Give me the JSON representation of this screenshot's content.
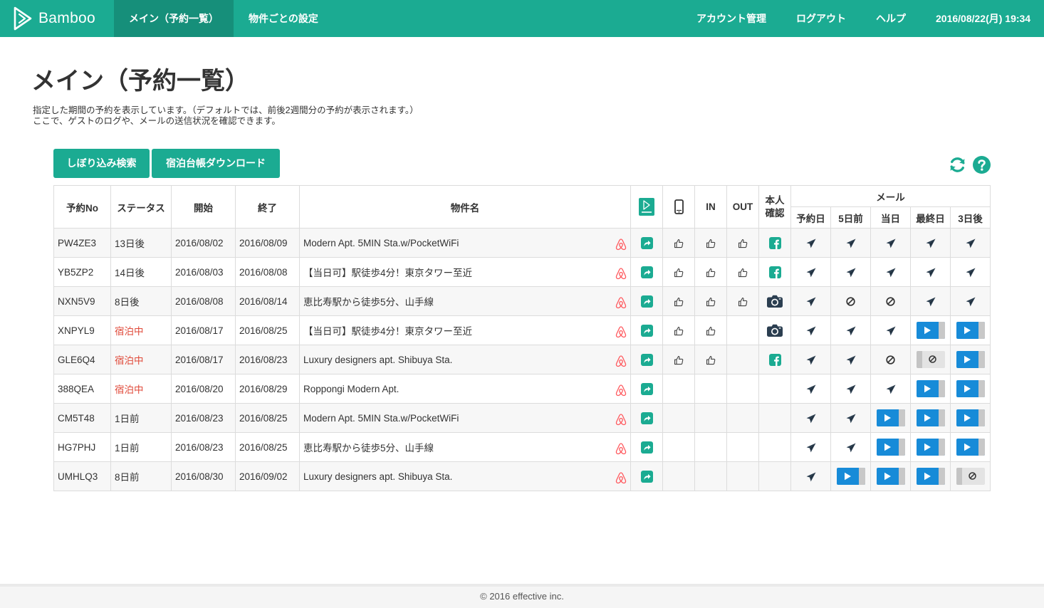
{
  "app": {
    "name": "Bamboo"
  },
  "nav": {
    "main": "メイン（予約一覧）",
    "settings": "物件ごとの設定",
    "account": "アカウント管理",
    "logout": "ログアウト",
    "help": "ヘルプ",
    "datetime": "2016/08/22(月) 19:34"
  },
  "colors": {
    "brand": "#1bab92",
    "brand_dark": "#168f7a",
    "alert": "#e04a3a",
    "play": "#178bd8",
    "airbnb": "#ff5a5f"
  },
  "page": {
    "title": "メイン（予約一覧）",
    "desc1": "指定した期間の予約を表示しています。（デフォルトでは、前後2週間分の予約が表示されます。）",
    "desc2": "ここで、ゲストのログや、メールの送信状況を確認できます。"
  },
  "buttons": {
    "filter": "しぼり込み検索",
    "download": "宿泊台帳ダウンロード"
  },
  "tools": [
    "refresh-icon",
    "help-icon"
  ],
  "table": {
    "headers": {
      "no": "予約No",
      "status": "ステータス",
      "start": "開始",
      "end": "終了",
      "property": "物件名",
      "in": "IN",
      "out": "OUT",
      "identity": "本人確認",
      "mail": "メール",
      "mail_cols": [
        "予約日",
        "5日前",
        "当日",
        "最終日",
        "3日後"
      ]
    },
    "rows": [
      {
        "no": "PW4ZE3",
        "status": "13日後",
        "alert": false,
        "start": "2016/08/02",
        "end": "2016/08/09",
        "property": "Modern Apt. 5MIN Sta.w/PocketWiFi",
        "phone": true,
        "in": true,
        "out": true,
        "id": "facebook",
        "mail": [
          "sent",
          "sent",
          "sent",
          "sent",
          "sent"
        ]
      },
      {
        "no": "YB5ZP2",
        "status": "14日後",
        "alert": false,
        "start": "2016/08/03",
        "end": "2016/08/08",
        "property": "【当日可】駅徒歩4分！東京タワー至近",
        "phone": true,
        "in": true,
        "out": true,
        "id": "facebook",
        "mail": [
          "sent",
          "sent",
          "sent",
          "sent",
          "sent"
        ]
      },
      {
        "no": "NXN5V9",
        "status": "8日後",
        "alert": false,
        "start": "2016/08/08",
        "end": "2016/08/14",
        "property": "恵比寿駅から徒歩5分、山手線",
        "phone": true,
        "in": true,
        "out": true,
        "id": "camera",
        "mail": [
          "sent",
          "blocked",
          "blocked",
          "sent",
          "sent"
        ]
      },
      {
        "no": "XNPYL9",
        "status": "宿泊中",
        "alert": true,
        "start": "2016/08/17",
        "end": "2016/08/25",
        "property": "【当日可】駅徒歩4分！東京タワー至近",
        "phone": true,
        "in": true,
        "out": false,
        "id": "camera",
        "mail": [
          "sent",
          "sent",
          "sent",
          "play",
          "play"
        ]
      },
      {
        "no": "GLE6Q4",
        "status": "宿泊中",
        "alert": true,
        "start": "2016/08/17",
        "end": "2016/08/23",
        "property": "Luxury designers apt. Shibuya Sta.",
        "phone": true,
        "in": true,
        "out": false,
        "id": "facebook",
        "mail": [
          "sent",
          "sent",
          "blocked",
          "off",
          "play"
        ]
      },
      {
        "no": "388QEA",
        "status": "宿泊中",
        "alert": true,
        "start": "2016/08/20",
        "end": "2016/08/29",
        "property": "Roppongi Modern Apt.",
        "phone": false,
        "in": false,
        "out": false,
        "id": "",
        "mail": [
          "sent",
          "sent",
          "sent",
          "play",
          "play"
        ]
      },
      {
        "no": "CM5T48",
        "status": "1日前",
        "alert": false,
        "start": "2016/08/23",
        "end": "2016/08/25",
        "property": "Modern Apt. 5MIN Sta.w/PocketWiFi",
        "phone": false,
        "in": false,
        "out": false,
        "id": "",
        "mail": [
          "sent",
          "sent",
          "play",
          "play",
          "play"
        ]
      },
      {
        "no": "HG7PHJ",
        "status": "1日前",
        "alert": false,
        "start": "2016/08/23",
        "end": "2016/08/25",
        "property": "恵比寿駅から徒歩5分、山手線",
        "phone": false,
        "in": false,
        "out": false,
        "id": "",
        "mail": [
          "sent",
          "sent",
          "play",
          "play",
          "play"
        ]
      },
      {
        "no": "UMHLQ3",
        "status": "8日前",
        "alert": false,
        "start": "2016/08/30",
        "end": "2016/09/02",
        "property": "Luxury designers apt. Shibuya Sta.",
        "phone": false,
        "in": false,
        "out": false,
        "id": "",
        "mail": [
          "sent",
          "play",
          "play",
          "play",
          "off"
        ]
      }
    ]
  },
  "footer": {
    "copyright": "© 2016 effective inc."
  }
}
